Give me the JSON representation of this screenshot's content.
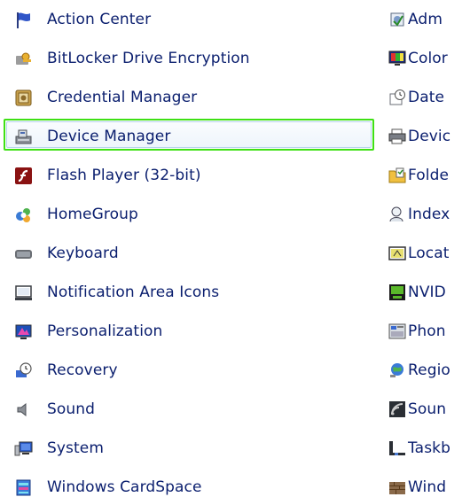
{
  "left_column": [
    {
      "label": "Action Center",
      "icon": "flag-icon"
    },
    {
      "label": "BitLocker Drive Encryption",
      "icon": "bitlocker-key-icon"
    },
    {
      "label": "Credential Manager",
      "icon": "vault-icon"
    },
    {
      "label": "Device Manager",
      "icon": "device-manager-icon",
      "selected": true
    },
    {
      "label": "Flash Player (32-bit)",
      "icon": "flash-icon"
    },
    {
      "label": "HomeGroup",
      "icon": "homegroup-icon"
    },
    {
      "label": "Keyboard",
      "icon": "keyboard-icon"
    },
    {
      "label": "Notification Area Icons",
      "icon": "notification-area-icon"
    },
    {
      "label": "Personalization",
      "icon": "personalization-icon"
    },
    {
      "label": "Recovery",
      "icon": "recovery-icon"
    },
    {
      "label": "Sound",
      "icon": "speaker-icon"
    },
    {
      "label": "System",
      "icon": "system-icon"
    },
    {
      "label": "Windows CardSpace",
      "icon": "cardspace-icon"
    }
  ],
  "right_column": [
    {
      "label": "Adm",
      "icon": "admin-tools-icon"
    },
    {
      "label": "Color",
      "icon": "color-management-icon"
    },
    {
      "label": "Date",
      "icon": "clock-icon"
    },
    {
      "label": "Devic",
      "icon": "devices-printers-icon"
    },
    {
      "label": "Folde",
      "icon": "folder-options-icon"
    },
    {
      "label": "Index",
      "icon": "indexing-icon"
    },
    {
      "label": "Locat",
      "icon": "location-icon"
    },
    {
      "label": "NVID",
      "icon": "nvidia-icon"
    },
    {
      "label": "Phon",
      "icon": "phone-modem-icon"
    },
    {
      "label": "Regio",
      "icon": "region-globe-icon"
    },
    {
      "label": "Soun",
      "icon": "speech-icon"
    },
    {
      "label": "Taskb",
      "icon": "taskbar-icon"
    },
    {
      "label": "Wind",
      "icon": "firewall-icon"
    }
  ],
  "colors": {
    "link_text": "#0a1e6e",
    "selection_outline": "#3ee014"
  }
}
